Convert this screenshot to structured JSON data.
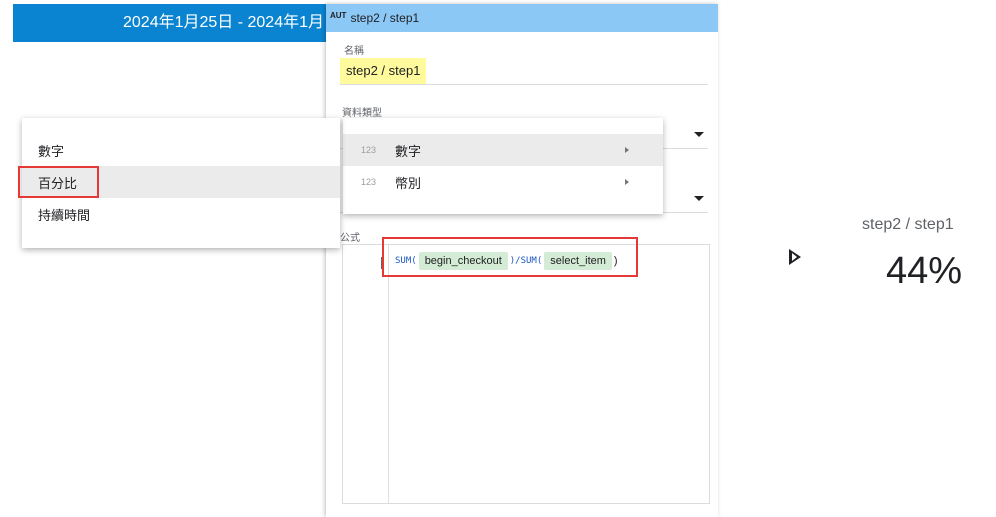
{
  "report": {
    "date_range": "2024年1月25日 - 2024年1月"
  },
  "editor": {
    "badge": "AUT",
    "header_title": "step2 / step1",
    "name_label": "名稱",
    "name_value": "step2 / step1",
    "type_label": "資料類型",
    "formula_label": "公式",
    "formula": {
      "fn1": "SUM(",
      "field1": "begin_checkout",
      "sep": ")/SUM(",
      "field2": "select_item",
      "close": ")"
    }
  },
  "type_menu": {
    "items": [
      {
        "icon": "123",
        "label": "數字",
        "active": true
      },
      {
        "icon": "123",
        "label": "幣別",
        "active": false
      }
    ]
  },
  "sub_menu": {
    "items": [
      {
        "label": "數字",
        "active": false
      },
      {
        "label": "百分比",
        "active": true
      },
      {
        "label": "持續時間",
        "active": false
      }
    ]
  },
  "scorecard": {
    "title": "step2 / step1",
    "value": "44%"
  },
  "colors": {
    "banner": "#0a84d0",
    "header": "#8cc8f6",
    "highlight": "#fffb9c",
    "chip": "#d4ecd5",
    "outline": "#e53935"
  }
}
